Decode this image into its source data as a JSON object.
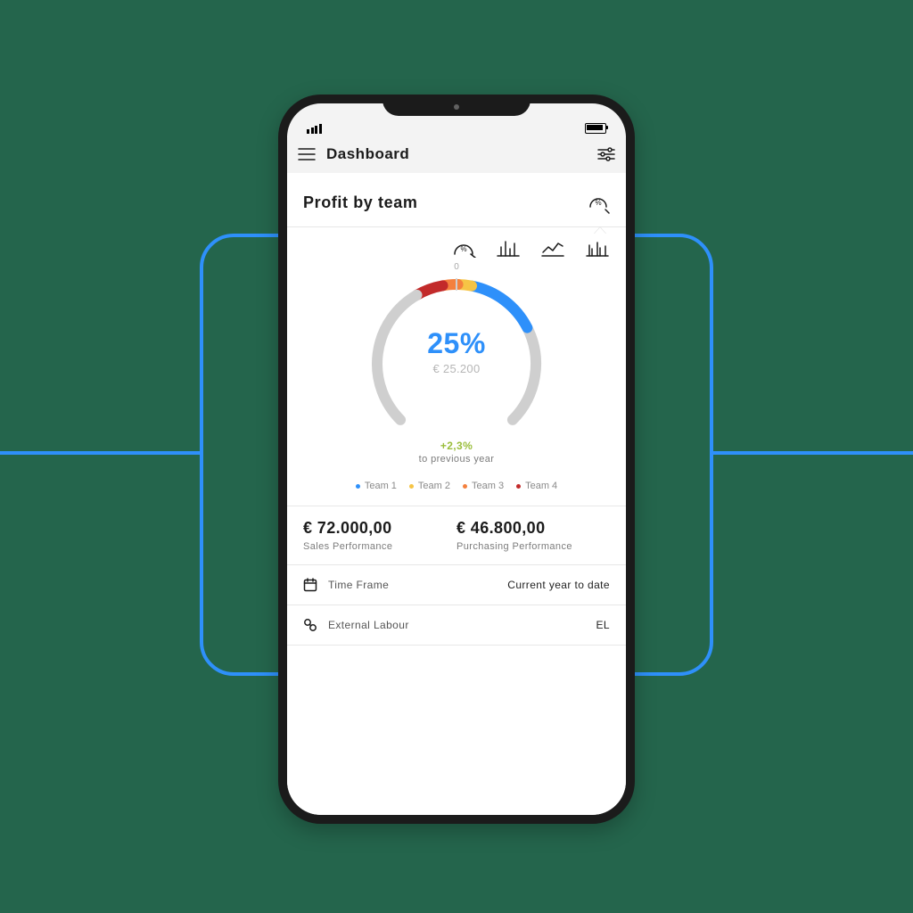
{
  "header": {
    "title": "Dashboard"
  },
  "section": {
    "title": "Profit by team",
    "gauge_zero_label": "0",
    "percent": "25%",
    "amount": "€ 25.200",
    "delta": "+2,3%",
    "delta_sub": "to previous year"
  },
  "legend": [
    {
      "label": "Team 1",
      "color": "#2e90fa"
    },
    {
      "label": "Team 2",
      "color": "#f6c445"
    },
    {
      "label": "Team 3",
      "color": "#f4803d"
    },
    {
      "label": "Team 4",
      "color": "#c22a2a"
    }
  ],
  "kpis": {
    "sales": {
      "value": "€ 72.000,00",
      "label": "Sales Performance"
    },
    "purchasing": {
      "value": "€ 46.800,00",
      "label": "Purchasing Performance"
    }
  },
  "details": {
    "timeframe": {
      "label": "Time Frame",
      "value": "Current year to date"
    },
    "ext": {
      "label": "External Labour",
      "value": "EL"
    }
  },
  "colors": {
    "team1": "#2e90fa",
    "team2": "#f6c445",
    "team3": "#f4803d",
    "team4": "#c22a2a",
    "track": "#cfcfcf"
  },
  "chart_data": {
    "type": "pie",
    "title": "Profit by team",
    "gauge_sweep_deg": 270,
    "segments_est_pct_of_shown": {
      "Team 4": 18,
      "Team 3": 10,
      "Team 2": 10,
      "Team 1": 62
    },
    "filled_fraction_of_full_gauge_est": 0.42,
    "series": [
      {
        "name": "Team 1",
        "color": "#2e90fa"
      },
      {
        "name": "Team 2",
        "color": "#f6c445"
      },
      {
        "name": "Team 3",
        "color": "#f4803d"
      },
      {
        "name": "Team 4",
        "color": "#c22a2a"
      }
    ],
    "center_value": "25%",
    "center_sub": "€ 25.200",
    "delta_vs_prev_year": "+2,3%"
  }
}
